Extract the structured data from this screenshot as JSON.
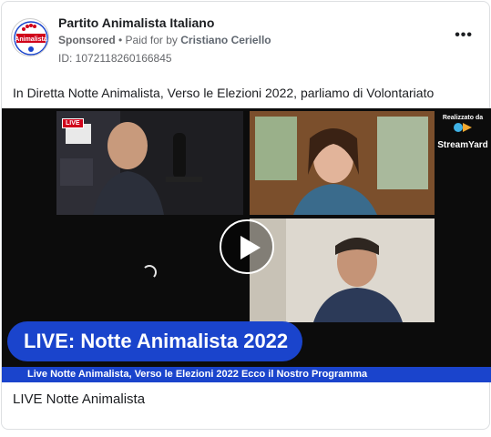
{
  "post": {
    "page_name": "Partito Animalista Italiano",
    "sponsored": "Sponsored",
    "separator": " • ",
    "paid_for_prefix": "Paid for by ",
    "payer": "Cristiano Ceriello",
    "ad_id": "ID: 1072118260166845",
    "more_label": "•••",
    "caption": "In Diretta Notte Animalista, Verso le Elezioni 2022, parliamo di Volontariato",
    "avatar_logo_text": "Animalista"
  },
  "video": {
    "live_tag": "LIVE",
    "overlay_banner": "LIVE: Notte Animalista 2022",
    "ticker": "Live Notte Animalista, Verso le Elezioni 2022 Ecco il Nostro Programma",
    "watermark_realized": "Realizzato da",
    "watermark_brand": "StreamYard"
  },
  "attachment": {
    "title": "LIVE Notte Animalista"
  },
  "colors": {
    "overlay_blue": "#1a44cc",
    "secondary_text": "#65676b",
    "border": "#dddfe2"
  }
}
